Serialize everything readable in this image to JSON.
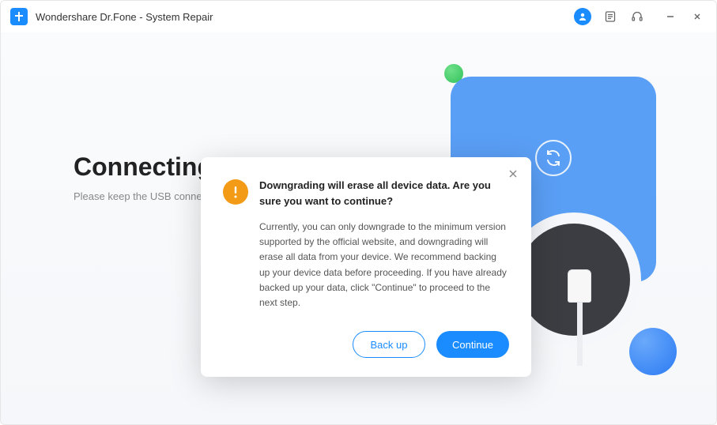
{
  "app": {
    "title": "Wondershare Dr.Fone - System Repair"
  },
  "main": {
    "heading": "Connecting...",
    "sub": "Please keep the USB connection"
  },
  "modal": {
    "title": "Downgrading will erase all device data. Are you sure you want to continue?",
    "body": "Currently, you can only downgrade to the minimum version supported by the official website, and downgrading will erase all data from your device. We recommend backing up your device data before proceeding. If you have already backed up your data, click \"Continue\" to proceed to the next step.",
    "backup_label": "Back up",
    "continue_label": "Continue"
  },
  "colors": {
    "accent": "#1a8cff",
    "warn": "#f39b17"
  }
}
